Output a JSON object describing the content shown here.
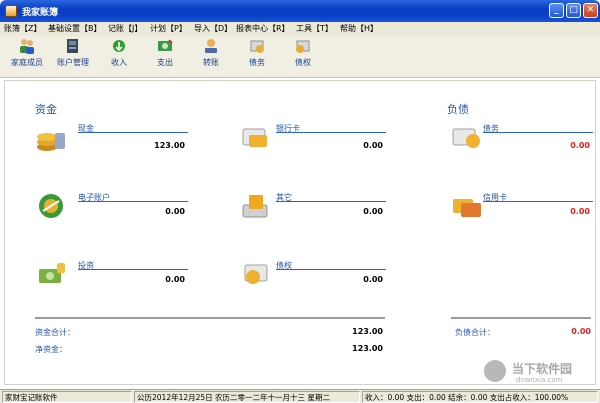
{
  "window": {
    "title": "我家账簿"
  },
  "menu": [
    "账簿【Z】",
    "基础设置【B】",
    "记账【J】",
    "计划【P】",
    "导入【D】",
    "报表中心【R】",
    "工具【T】",
    "帮助【H】"
  ],
  "toolbar": [
    "家庭成员",
    "账户管理",
    "收入",
    "支出",
    "转账",
    "债务",
    "债权"
  ],
  "assets": {
    "title": "资金",
    "accounts": [
      {
        "label": "现金",
        "value": "123.00",
        "icon": "coins-icon"
      },
      {
        "label": "银行卡",
        "value": "0.00",
        "icon": "bank-card-icon"
      },
      {
        "label": "电子账户",
        "value": "0.00",
        "icon": "e-account-icon"
      },
      {
        "label": "其它",
        "value": "0.00",
        "icon": "other-icon"
      },
      {
        "label": "投资",
        "value": "0.00",
        "icon": "investment-icon"
      },
      {
        "label": "债权",
        "value": "0.00",
        "icon": "claims-icon"
      }
    ],
    "total_label": "资金合计：",
    "total_value": "123.00",
    "net_label": "净资金：",
    "net_value": "123.00"
  },
  "liabilities": {
    "title": "负债",
    "accounts": [
      {
        "label": "债务",
        "value": "0.00",
        "icon": "debt-icon"
      },
      {
        "label": "信用卡",
        "value": "0.00",
        "icon": "credit-card-icon"
      }
    ],
    "total_label": "负债合计：",
    "total_value": "0.00"
  },
  "statusbar": {
    "app": "家财宝记账软件",
    "date": "公历2012年12月25日 农历二零一二年十一月十三  星期二",
    "summary": "收入：0.00 支出：0.00 结余：0.00 支出占收入：100.00%"
  },
  "watermark": {
    "name": "当下软件园",
    "url": "downxia.com"
  },
  "colors": {
    "accent": "#2255aa",
    "negative": "#e02020",
    "titlebar": "#0a40c8"
  }
}
